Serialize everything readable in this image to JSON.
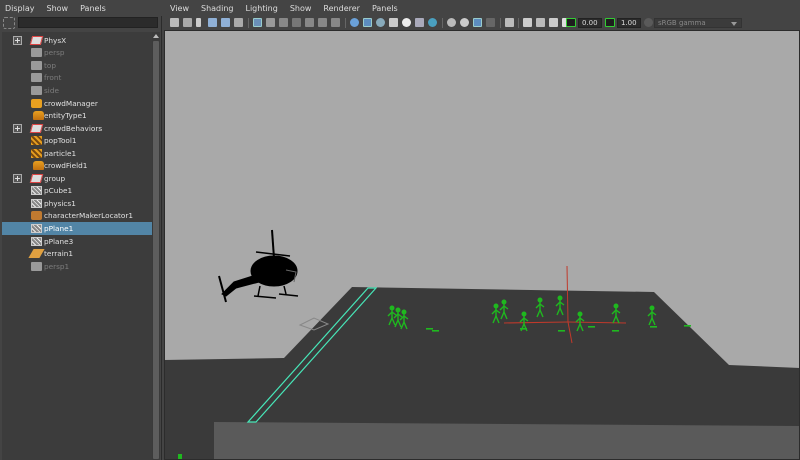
{
  "outliner": {
    "menu": [
      "Display",
      "Show",
      "Panels"
    ],
    "search_value": "",
    "items": [
      {
        "label": "PhysX",
        "icon": "transform-icon",
        "expandable": true,
        "dim": false,
        "selected": false
      },
      {
        "label": "persp",
        "icon": "camera-icon",
        "expandable": false,
        "dim": true,
        "selected": false
      },
      {
        "label": "top",
        "icon": "camera-icon",
        "expandable": false,
        "dim": true,
        "selected": false
      },
      {
        "label": "front",
        "icon": "camera-icon",
        "expandable": false,
        "dim": true,
        "selected": false
      },
      {
        "label": "side",
        "icon": "camera-icon",
        "expandable": false,
        "dim": true,
        "selected": false
      },
      {
        "label": "crowdManager",
        "icon": "crowd-manager-icon",
        "expandable": false,
        "dim": false,
        "selected": false
      },
      {
        "label": "entityType1",
        "icon": "figure-icon",
        "expandable": false,
        "dim": false,
        "selected": false
      },
      {
        "label": "crowdBehaviors",
        "icon": "transform-icon",
        "expandable": true,
        "dim": false,
        "selected": false
      },
      {
        "label": "popTool1",
        "icon": "pop-tool-icon",
        "expandable": false,
        "dim": false,
        "selected": false
      },
      {
        "label": "particle1",
        "icon": "pop-tool-icon",
        "expandable": false,
        "dim": false,
        "selected": false
      },
      {
        "label": "crowdField1",
        "icon": "figure-icon",
        "expandable": false,
        "dim": false,
        "selected": false
      },
      {
        "label": "group",
        "icon": "transform-icon",
        "expandable": true,
        "dim": false,
        "selected": false
      },
      {
        "label": "pCube1",
        "icon": "mesh-icon",
        "expandable": false,
        "dim": false,
        "selected": false
      },
      {
        "label": "physics1",
        "icon": "mesh-icon",
        "expandable": false,
        "dim": false,
        "selected": false
      },
      {
        "label": "characterMakerLocator1",
        "icon": "locator-icon",
        "expandable": false,
        "dim": false,
        "selected": false
      },
      {
        "label": "pPlane1",
        "icon": "mesh-icon",
        "expandable": false,
        "dim": false,
        "selected": true
      },
      {
        "label": "pPlane3",
        "icon": "mesh-icon",
        "expandable": false,
        "dim": false,
        "selected": false
      },
      {
        "label": "terrain1",
        "icon": "terrain-icon",
        "expandable": false,
        "dim": false,
        "selected": false
      },
      {
        "label": "persp1",
        "icon": "camera-icon",
        "expandable": false,
        "dim": true,
        "selected": false
      }
    ]
  },
  "viewport": {
    "menu": [
      "View",
      "Shading",
      "Lighting",
      "Show",
      "Renderer",
      "Panels"
    ],
    "toolbar": {
      "exposure_value": "0.00",
      "gamma_value": "1.00",
      "color_space": "sRGB gamma"
    },
    "colors": {
      "background": "#a9a9a9",
      "ground": "#3a3a3a",
      "agents": "#1fb81f",
      "selection_highlight": "#5285a6",
      "wire_highlight": "#47e6b8",
      "manipulator": "#c0392b"
    }
  }
}
